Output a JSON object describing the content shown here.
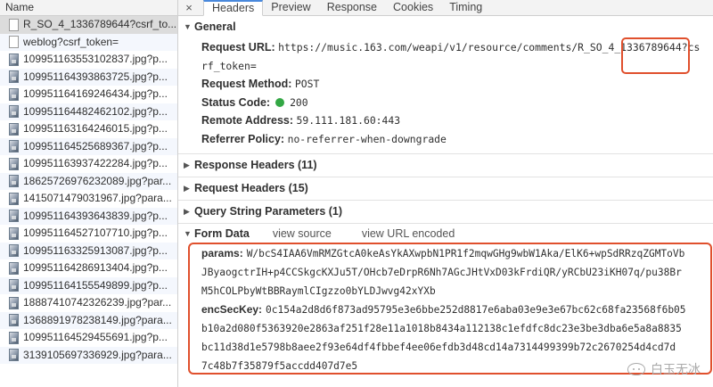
{
  "left_panel": {
    "header": "Name",
    "requests": [
      {
        "name": "R_SO_4_1336789644?csrf_to...",
        "icon": "document-icon"
      },
      {
        "name": "weblog?csrf_token=",
        "icon": "document-icon"
      },
      {
        "name": "109951163553102837.jpg?p...",
        "icon": "image-icon"
      },
      {
        "name": "109951164393863725.jpg?p...",
        "icon": "image-icon"
      },
      {
        "name": "109951164169246434.jpg?p...",
        "icon": "image-icon"
      },
      {
        "name": "109951164482462102.jpg?p...",
        "icon": "image-icon"
      },
      {
        "name": "109951163164246015.jpg?p...",
        "icon": "image-icon"
      },
      {
        "name": "109951164525689367.jpg?p...",
        "icon": "image-icon"
      },
      {
        "name": "109951163937422284.jpg?p...",
        "icon": "image-icon"
      },
      {
        "name": "18625726976232089.jpg?par...",
        "icon": "image-icon"
      },
      {
        "name": "1415071479031967.jpg?para...",
        "icon": "image-icon"
      },
      {
        "name": "109951164393643839.jpg?p...",
        "icon": "image-icon"
      },
      {
        "name": "109951164527107710.jpg?p...",
        "icon": "image-icon"
      },
      {
        "name": "109951163325913087.jpg?p...",
        "icon": "image-icon"
      },
      {
        "name": "109951164286913404.jpg?p...",
        "icon": "image-icon"
      },
      {
        "name": "109951164155549899.jpg?p...",
        "icon": "image-icon"
      },
      {
        "name": "18887410742326239.jpg?par...",
        "icon": "image-icon"
      },
      {
        "name": "1368891978238149.jpg?para...",
        "icon": "image-icon"
      },
      {
        "name": "109951164529455691.jpg?p...",
        "icon": "image-icon"
      },
      {
        "name": "3139105697336929.jpg?para...",
        "icon": "image-icon"
      }
    ]
  },
  "tabs": {
    "close": "×",
    "items": [
      "Headers",
      "Preview",
      "Response",
      "Cookies",
      "Timing"
    ],
    "active": "Headers"
  },
  "general": {
    "title": "General",
    "request_url_label": "Request URL:",
    "request_url_value_1": "https://music.163.com/weapi/v1/resource/comments/R_SO_4_1336789644?cs",
    "request_url_value_2": "rf_token=",
    "request_method_label": "Request Method:",
    "request_method_value": "POST",
    "status_code_label": "Status Code:",
    "status_code_value": "200",
    "status_color": "#33a744",
    "remote_address_label": "Remote Address:",
    "remote_address_value": "59.111.181.60:443",
    "referrer_policy_label": "Referrer Policy:",
    "referrer_policy_value": "no-referrer-when-downgrade"
  },
  "sections": {
    "response_headers": "Response Headers (11)",
    "request_headers": "Request Headers (15)",
    "query_string": "Query String Parameters (1)"
  },
  "form_data": {
    "title": "Form Data",
    "view_source": "view source",
    "view_url_encoded": "view URL encoded",
    "params_label": "params:",
    "params_lines": [
      "W/bcS4IAA6VmRMZGtcA0keAsYkAXwpbN1PR1f2mqwGHg9wbW1Aka/ElK6+wpSdRRzqZGMToVb",
      "JByaogctrIH+p4CCSkgcKXJu5T/OHcb7eDrpR6Nh7AGcJHtVxD03kFrdiQR/yRCbU23iKH07q/pu38Br",
      "M5hCOLPbyWtBBRaymlCIgzzo0bYLDJwvg42xYXb"
    ],
    "enc_label": "encSecKey:",
    "enc_lines": [
      "0c154a2d8d6f873ad95795e3e6bbe252d8817e6aba03e9e3e67bc62c68fa23568f6b05",
      "b10a2d080f5363920e2863af251f28e11a1018b8434a112138c1efdfc8dc23e3be3dba6e5a8a8835",
      "bc11d38d1e5798b8aee2f93e64df4fbbef4ee06efdb3d48cd14a7314499399b72c2670254d4cd7d",
      "7c48b7f35879f5accdd407d7e5"
    ]
  },
  "annotation_color": "#e0502d",
  "watermark": "白玉无冰"
}
